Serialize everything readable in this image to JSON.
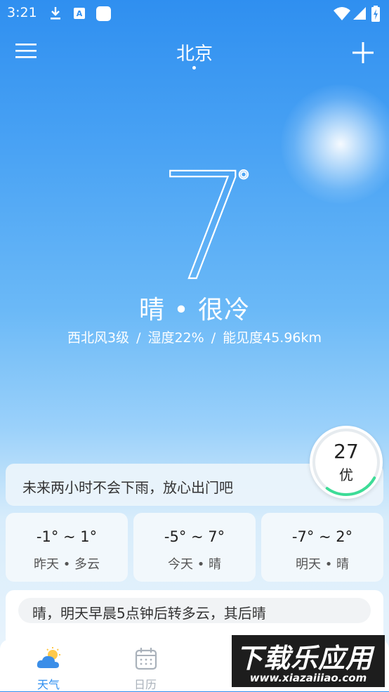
{
  "status_bar": {
    "time": "3:21",
    "icons": [
      "download-icon",
      "a-notification-icon",
      "app-square-icon",
      "wifi-icon",
      "signal-icon",
      "battery-charging-icon"
    ]
  },
  "header": {
    "city": "北京",
    "menu_icon": "hamburger-menu-icon",
    "add_icon": "plus-icon"
  },
  "current": {
    "temperature": "7",
    "degree_symbol": "°",
    "condition": "晴 • 很冷",
    "wind": "西北风3级",
    "humidity": "湿度22%",
    "visibility": "能见度45.96km",
    "separator": "/"
  },
  "rain_notice": "未来两小时不会下雨，放心出门吧",
  "aqi": {
    "value": "27",
    "level": "优",
    "progress": 0.27,
    "color": "#3ddc97"
  },
  "forecast": [
    {
      "range": "-1° ~ 1°",
      "label": "昨天 • 多云"
    },
    {
      "range": "-5° ~ 7°",
      "label": "今天 • 晴"
    },
    {
      "range": "-7° ~ 2°",
      "label": "明天 • 晴"
    }
  ],
  "summary": "晴，明天早晨5点钟后转多云，其后晴",
  "bottom_nav": [
    {
      "label": "天气",
      "icon": "weather-icon",
      "active": true
    },
    {
      "label": "日历",
      "icon": "calendar-icon",
      "active": false
    }
  ],
  "watermark": {
    "main": "下载乐应用",
    "sub": "www.xiazaiiiao.com"
  },
  "colors": {
    "accent": "#2f8ff0",
    "nav_active": "#2f8ff0",
    "nav_inactive": "#aab2bb"
  }
}
